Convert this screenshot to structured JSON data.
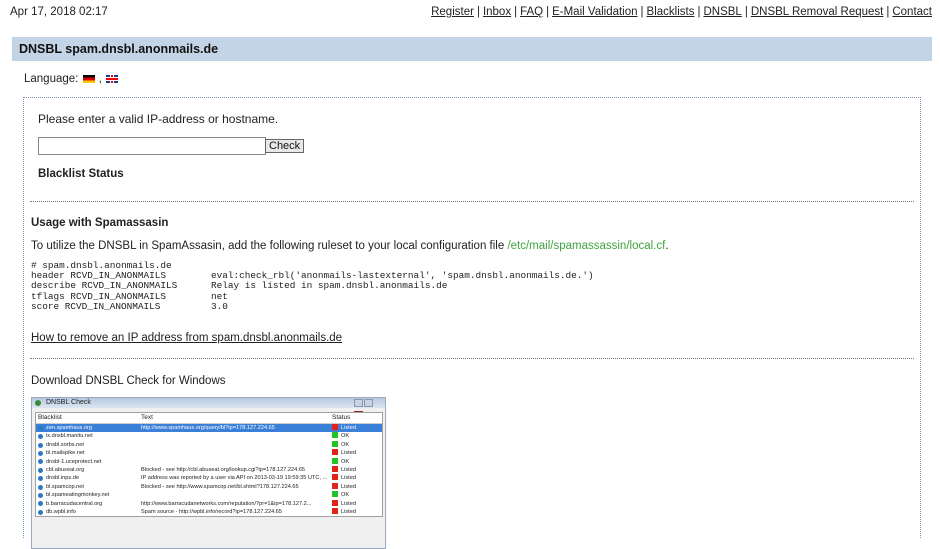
{
  "header": {
    "date": "Apr 17, 2018 02:17",
    "nav": [
      "Register",
      "Inbox",
      "FAQ",
      "E-Mail Validation",
      "Blacklists",
      "DNSBL",
      "DNSBL Removal Request",
      "Contact"
    ]
  },
  "title": "DNSBL spam.dnsbl.anonmails.de",
  "language": {
    "label": "Language:",
    "separator": ",",
    "flags": [
      "german-flag-icon",
      "uk-flag-icon"
    ]
  },
  "check": {
    "prompt": "Please enter a valid IP-address or hostname.",
    "input_value": "",
    "button_label": "Check",
    "status_heading": "Blacklist Status"
  },
  "usage": {
    "heading": "Usage with Spamassasin",
    "text": "To utilize the DNSBL in SpamAssasin, add the following ruleset to your local configuration file",
    "path": "/etc/mail/spamassassin/local.cf",
    "period": ".",
    "code": "# spam.dnsbl.anonmails.de\nheader RCVD_IN_ANONMAILS        eval:check_rbl('anonmails-lastexternal', 'spam.dnsbl.anonmails.de.')\ndescribe RCVD_IN_ANONMAILS      Relay is listed in spam.dnsbl.anonmails.de\ntflags RCVD_IN_ANONMAILS        net\nscore RCVD_IN_ANONMAILS         3.0"
  },
  "remove_link": "How to remove an IP address from spam.dnsbl.anonmails.de",
  "download": {
    "title": "Download DNSBL Check for Windows",
    "window_title": "DNSBL Check",
    "columns": [
      "Blacklist",
      "Text",
      "Status"
    ],
    "rows": [
      {
        "name": "zen.spamhaus.org",
        "text": "http://www.spamhaus.org/query/bl?ip=178.127.224.65",
        "status": "Listed",
        "color": "#e0241c",
        "selected": true
      },
      {
        "name": "ix.dnsbl.manitu.net",
        "text": "",
        "status": "OK",
        "color": "#22c322"
      },
      {
        "name": "dnsbl.sorbs.net",
        "text": "",
        "status": "OK",
        "color": "#22c322"
      },
      {
        "name": "bl.mailspike.net",
        "text": "",
        "status": "Listed",
        "color": "#e0241c"
      },
      {
        "name": "dnsbl-1.uceprotect.net",
        "text": "",
        "status": "OK",
        "color": "#22c322"
      },
      {
        "name": "cbl.abuseat.org",
        "text": "Blocked - see http://cbl.abuseat.org/lookup.cgi?ip=178.127.224.65",
        "status": "Listed",
        "color": "#e0241c"
      },
      {
        "name": "dnsbl.inps.de",
        "text": "IP address was reported by a user via API on 2013-03-19 19:59:35 UTC, ...",
        "status": "Listed",
        "color": "#e0241c"
      },
      {
        "name": "bl.spamcop.net",
        "text": "Blocked - see http://www.spamcop.net/bl.shtml?178.127.224.65",
        "status": "Listed",
        "color": "#e0241c"
      },
      {
        "name": "bl.spameatingmonkey.net",
        "text": "",
        "status": "OK",
        "color": "#22c322"
      },
      {
        "name": "b.barracudacentral.org",
        "text": "http://www.barracudanetworks.com/reputation/?pr=1&ip=178.127.2...",
        "status": "Listed",
        "color": "#e0241c"
      },
      {
        "name": "db.wpbl.info",
        "text": "Spam source - http://wpbl.info/record?ip=178.127.224.65",
        "status": "Listed",
        "color": "#e0241c"
      }
    ]
  }
}
